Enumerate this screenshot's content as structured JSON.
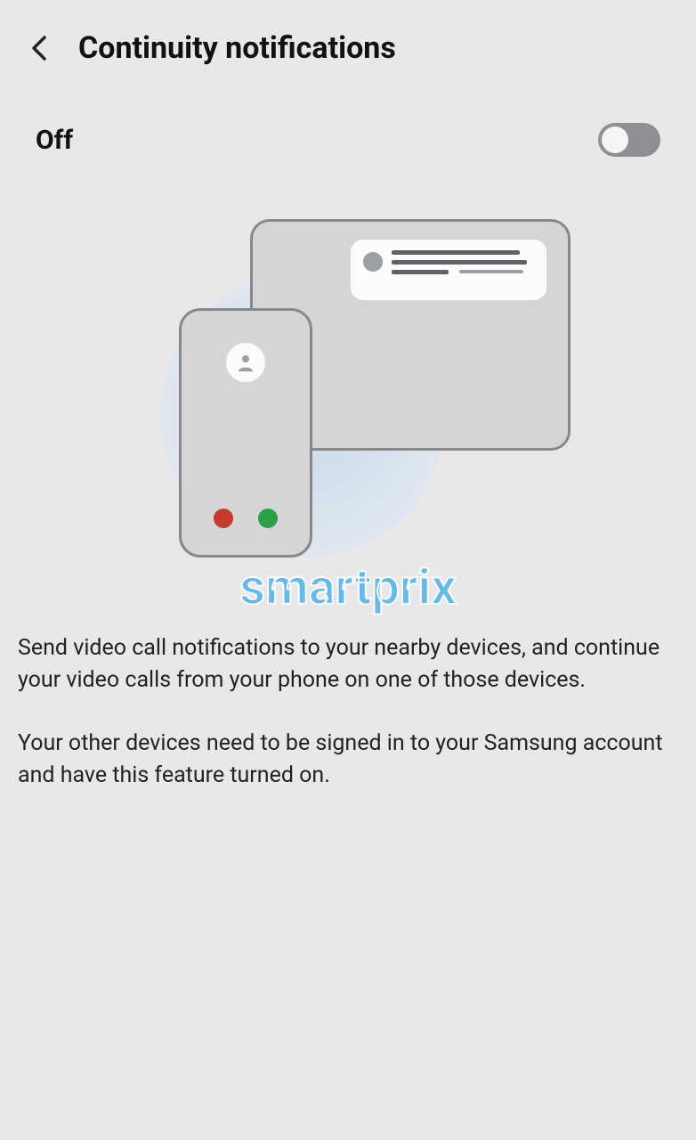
{
  "header": {
    "title": "Continuity notifications"
  },
  "toggle": {
    "state_label": "Off",
    "enabled": false
  },
  "watermark": "smartprix",
  "description": {
    "para1": "Send video call notifications to your nearby devices, and continue your video calls from your phone on one of those devices.",
    "para2": "Your other devices need to be signed in to your Samsung account and have this feature turned on."
  }
}
